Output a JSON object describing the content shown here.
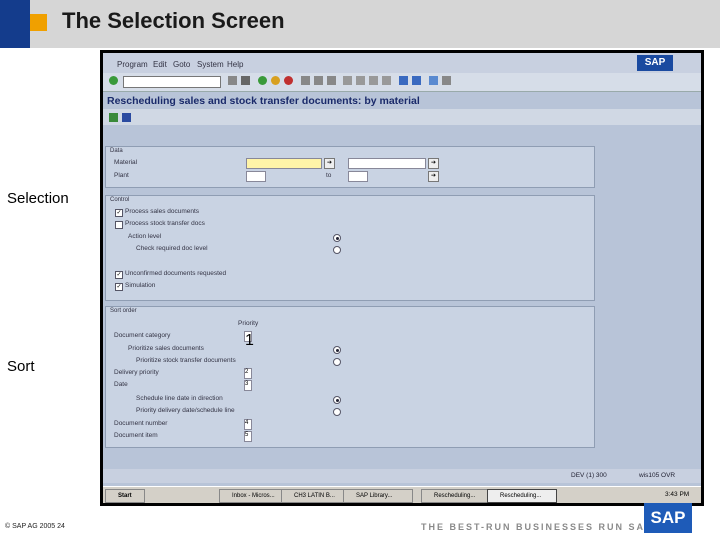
{
  "slide": {
    "title": "The Selection Screen",
    "side_labels": [
      "Selection",
      "Sort"
    ],
    "footer_copyright": "© SAP AG 2005 24",
    "tagline": "THE BEST-RUN BUSINESSES RUN SAP",
    "logo_text": "SAP"
  },
  "sap_window": {
    "menu": [
      "Program",
      "Edit",
      "Goto",
      "System",
      "Help"
    ],
    "logo_text": "SAP",
    "app_title": "Rescheduling sales and stock transfer documents: by material",
    "data_group": {
      "title": "Data",
      "material_label": "Material",
      "plant_label": "Plant",
      "to_label": "to"
    },
    "control_group": {
      "title": "Control",
      "items": [
        "Process sales documents",
        "Process stock transfer docs",
        "Action level",
        "Check required doc level",
        "Unconfirmed documents requested",
        "Simulation"
      ]
    },
    "sort_group": {
      "title": "Sort order",
      "priority_header": "Priority",
      "items": [
        "Document category",
        "Prioritize sales documents",
        "Prioritize stock transfer documents",
        "Delivery priority",
        "Date",
        "Schedule line date in direction",
        "Priority delivery date/schedule line",
        "Document number",
        "Document item"
      ],
      "values": [
        "1",
        "2",
        "3",
        "4",
        "5"
      ]
    },
    "status_text": "DEV (1) 300",
    "status_server": "wis105 OVR",
    "taskbar": {
      "start": "Start",
      "tasks": [
        "Inbox - Micros...",
        "CH3 LATIN B...",
        "SAP Library...",
        "Rescheduling...",
        "Rescheduling..."
      ],
      "time": "3:43 PM"
    }
  }
}
